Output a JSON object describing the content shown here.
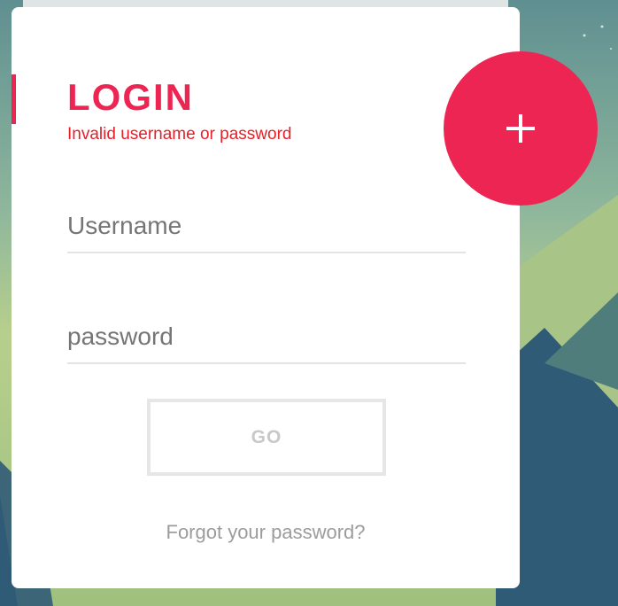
{
  "login": {
    "title": "LOGIN",
    "error": "Invalid username or password",
    "username_placeholder": "Username",
    "password_placeholder": "password",
    "submit_label": "GO",
    "forgot_label": "Forgot your password?"
  },
  "fab": {
    "icon": "plus-icon"
  },
  "colors": {
    "accent": "#ed2553",
    "error": "#e5202a",
    "muted_text": "#9c9c9c",
    "field_text": "#757575"
  }
}
